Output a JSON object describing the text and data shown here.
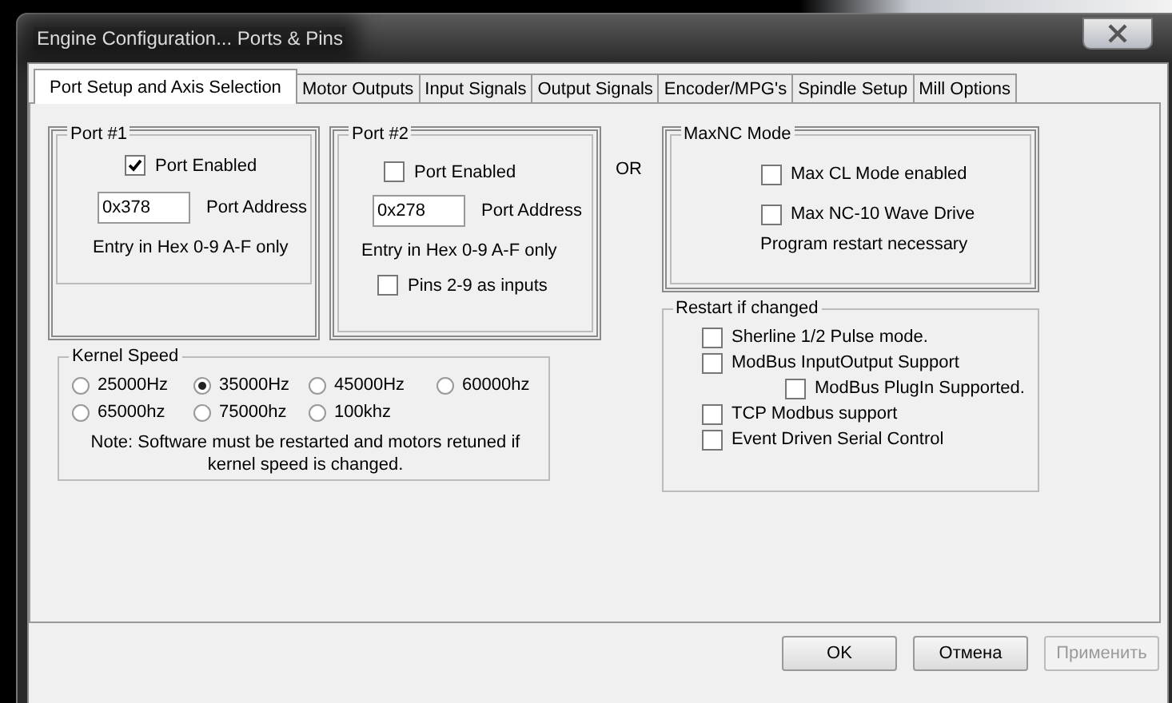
{
  "window": {
    "title": "Engine Configuration... Ports & Pins"
  },
  "tabs": [
    {
      "label": "Port Setup and Axis Selection",
      "selected": true
    },
    {
      "label": "Motor Outputs",
      "selected": false
    },
    {
      "label": "Input Signals",
      "selected": false
    },
    {
      "label": "Output Signals",
      "selected": false
    },
    {
      "label": "Encoder/MPG's",
      "selected": false
    },
    {
      "label": "Spindle Setup",
      "selected": false
    },
    {
      "label": "Mill Options",
      "selected": false
    }
  ],
  "ports": [
    {
      "legend": "Port #1",
      "enabled": {
        "label": "Port Enabled",
        "checked": true
      },
      "address": {
        "value": "0x378",
        "label": "Port Address"
      },
      "hint": "Entry in Hex 0-9 A-F only"
    },
    {
      "legend": "Port #2",
      "enabled": {
        "label": "Port Enabled",
        "checked": false
      },
      "address": {
        "value": "0x278",
        "label": "Port Address"
      },
      "hint": "Entry in Hex 0-9 A-F only",
      "pins_option": {
        "label": "Pins 2-9 as inputs",
        "checked": false
      }
    }
  ],
  "or_label": "OR",
  "maxnc": {
    "legend": "MaxNC Mode",
    "options": [
      {
        "label": "Max CL Mode enabled",
        "checked": false
      },
      {
        "label": "Max NC-10 Wave Drive",
        "checked": false
      }
    ],
    "note": "Program restart necessary"
  },
  "restart": {
    "legend": "Restart if changed",
    "options": [
      {
        "label": "Sherline 1/2 Pulse mode.",
        "checked": false
      },
      {
        "label": "ModBus InputOutput Support",
        "checked": false,
        "children": [
          {
            "label": "ModBus PlugIn Supported.",
            "checked": false
          }
        ]
      },
      {
        "label": "TCP Modbus support",
        "checked": false
      },
      {
        "label": "Event Driven Serial Control",
        "checked": false
      }
    ]
  },
  "kernel": {
    "legend": "Kernel Speed",
    "options": [
      {
        "label": "25000Hz",
        "selected": false
      },
      {
        "label": "35000Hz",
        "selected": true
      },
      {
        "label": "45000Hz",
        "selected": false
      },
      {
        "label": "60000hz",
        "selected": false
      },
      {
        "label": "65000hz",
        "selected": false
      },
      {
        "label": "75000hz",
        "selected": false
      },
      {
        "label": "100khz",
        "selected": false
      }
    ],
    "note": "Note: Software must be restarted and motors retuned if kernel speed is changed."
  },
  "buttons": [
    {
      "label": "OK",
      "disabled": false
    },
    {
      "label": "Отмена",
      "disabled": false
    },
    {
      "label": "Применить",
      "disabled": true
    }
  ]
}
